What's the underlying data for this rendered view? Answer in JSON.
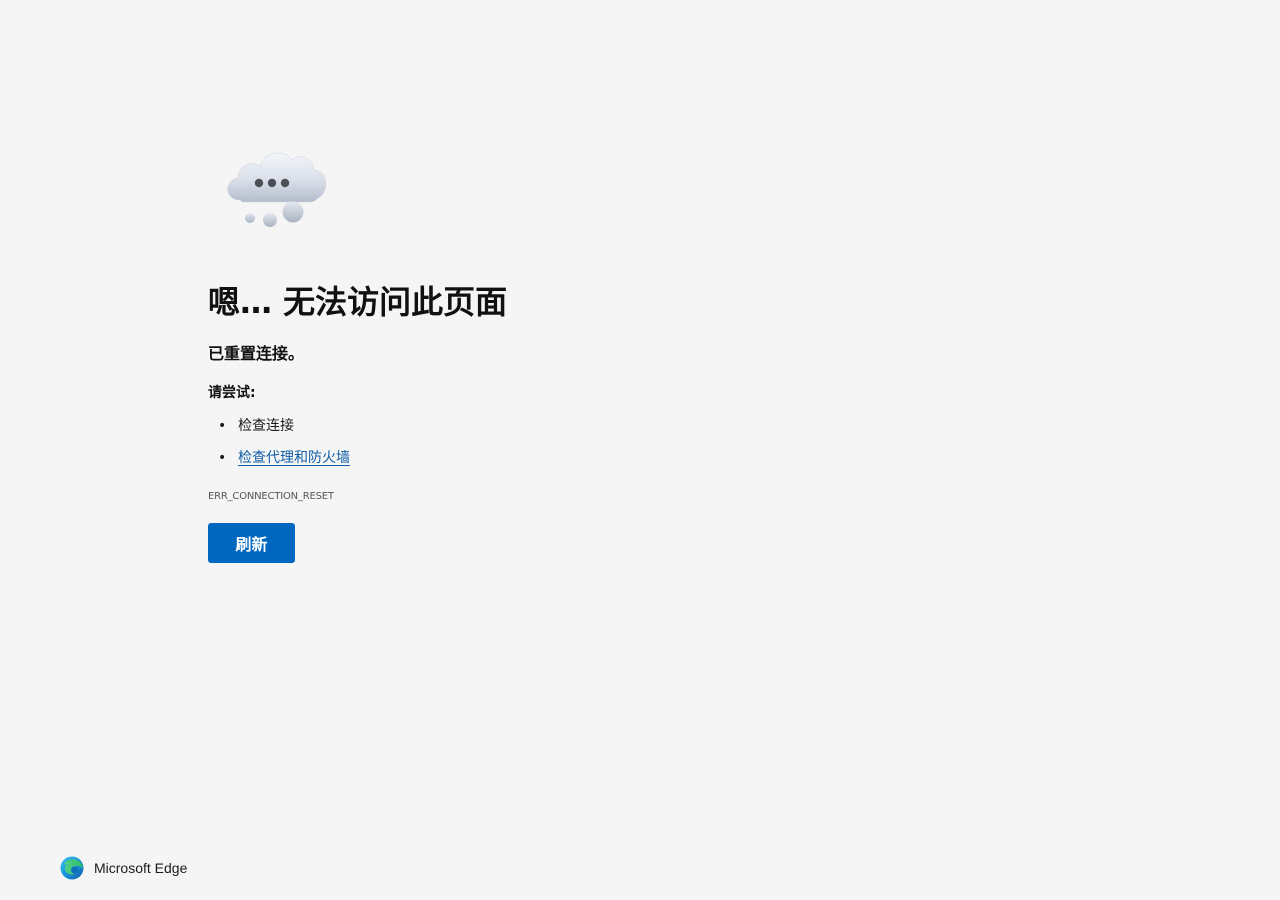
{
  "error": {
    "headline": "嗯… 无法访问此页面",
    "subheading": "已重置连接。",
    "try_label": "请尝试:",
    "suggestions": [
      {
        "text": "检查连接",
        "is_link": false
      },
      {
        "text": "检查代理和防火墙",
        "is_link": true
      }
    ],
    "bullet": "•",
    "error_code": "ERR_CONNECTION_RESET",
    "refresh_label": "刷新"
  },
  "footer": {
    "brand_name": "Microsoft Edge"
  },
  "colors": {
    "background": "#f5f5f5",
    "accent_button": "#0067c0",
    "link": "#0f5ea6"
  },
  "icons": {
    "illustration": "cloud-thinking-icon",
    "brand": "edge-logo-icon"
  }
}
